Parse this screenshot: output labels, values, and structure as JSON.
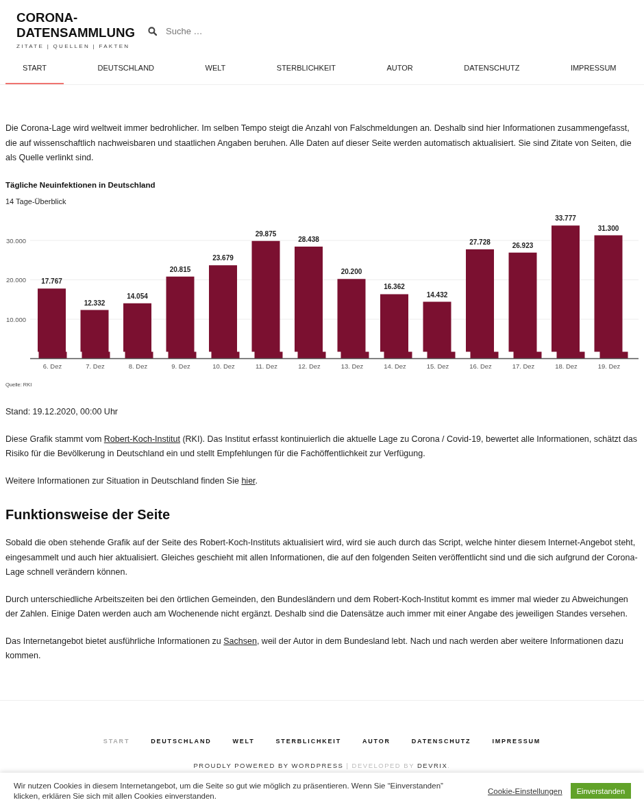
{
  "header": {
    "logo": "CORONA-DATENSAMMLUNG",
    "tagline": "ZITATE | QUELLEN | FAKTEN",
    "search": {
      "placeholder": "Suche …"
    }
  },
  "nav": {
    "items": [
      {
        "label": "START",
        "selected": true
      },
      {
        "label": "DEUTSCHLAND",
        "selected": false
      },
      {
        "label": "WELT",
        "selected": false
      },
      {
        "label": "STERBLICHKEIT",
        "selected": false
      },
      {
        "label": "AUTOR",
        "selected": false
      },
      {
        "label": "DATENSCHUTZ",
        "selected": false
      },
      {
        "label": "IMPRESSUM",
        "selected": false
      }
    ]
  },
  "content": [
    {
      "kind": "paragraph",
      "parts": [
        {
          "kind": "text",
          "text": "Die Corona-Lage wird weltweit immer bedrohlicher. Im selben Tempo steigt die Anzahl von Falschmeldungen an. Deshalb sind hier Informationen zusammengefasst, die auf wissenschaftlich nachweisbaren und staatlichen Angaben beruhen. Alle Daten auf dieser Seite werden automatisch aktualisiert. Sie sind Zitate von Seiten, die als Quelle verlinkt sind."
        }
      ]
    },
    {
      "kind": "chart",
      "subtitle": "14 Tage-Überblick",
      "source": "Quelle: RKI",
      "chart_data": {
        "type": "bar",
        "title": "Tägliche Neuinfektionen in Deutschland",
        "categories": [
          "6. Dez",
          "7. Dez",
          "8. Dez",
          "9. Dez",
          "10. Dez",
          "11. Dez",
          "12. Dez",
          "13. Dez",
          "14. Dez",
          "15. Dez",
          "16. Dez",
          "17. Dez",
          "18. Dez",
          "19. Dez"
        ],
        "values": [
          17767,
          12332,
          14054,
          20815,
          23679,
          29875,
          28438,
          20200,
          16362,
          14432,
          27728,
          26923,
          33777,
          31300
        ],
        "value_labels": [
          "17.767",
          "12.332",
          "14.054",
          "20.815",
          "23.679",
          "29.875",
          "28.438",
          "20.200",
          "16.362",
          "14.432",
          "27.728",
          "26.923",
          "33.777",
          "31.300"
        ],
        "ylim": [
          0,
          33777
        ],
        "yticks": [
          {
            "value": 10000,
            "label": "10.000"
          },
          {
            "value": 20000,
            "label": "20.000"
          },
          {
            "value": 30000,
            "label": "30.000"
          }
        ],
        "grid": true
      }
    },
    {
      "kind": "paragraph",
      "parts": [
        {
          "kind": "text",
          "text": "Stand: 19.12.2020, 00:00 Uhr"
        }
      ]
    },
    {
      "kind": "paragraph",
      "parts": [
        {
          "kind": "text",
          "text": "Diese Grafik stammt vom "
        },
        {
          "kind": "link",
          "text": "Robert-Koch-Institut"
        },
        {
          "kind": "text",
          "text": " (RKI). Das Institut erfasst kontinuierlich die aktuelle Lage zu Corona / Covid-19, bewertet alle Informationen, schätzt das Risiko für die Bevölkerung in Deutschland ein und stellt Empfehlungen für die Fachöffentlichkeit zur Verfügung."
        }
      ]
    },
    {
      "kind": "paragraph",
      "parts": [
        {
          "kind": "text",
          "text": "Weitere Informationen zur Situation in Deutschland finden Sie "
        },
        {
          "kind": "link",
          "text": "hier"
        },
        {
          "kind": "text",
          "text": "."
        }
      ]
    },
    {
      "kind": "heading",
      "text": "Funktionsweise der Seite"
    },
    {
      "kind": "paragraph",
      "parts": [
        {
          "kind": "text",
          "text": "Sobald die oben stehende Grafik auf der Seite des Robert-Koch-Instituts aktualisiert wird, wird sie auch durch das Script, welche hinter diesem Internet-Angebot steht, eingesammelt und auch hier aktualisiert. Gleiches geschieht mit allen Informationen, die auf den folgenden Seiten veröffentlicht sind und die sich aufgrund der Corona-Lage schnell verändern können."
        }
      ]
    },
    {
      "kind": "paragraph",
      "parts": [
        {
          "kind": "text",
          "text": "Durch unterschiedliche Arbeitszeiten bei den örtlichen Gemeinden, den Bundesländern und dem Robert-Koch-Institut kommt es immer mal wieder zu Abweichungen der Zahlen. Einige Daten werden auch am Wochenende nicht ergänzt. Deshalb sind die Datensätze auch immer mit einer Angabe des jeweiligen Standes versehen."
        }
      ]
    },
    {
      "kind": "paragraph",
      "parts": [
        {
          "kind": "text",
          "text": "Das Internetangebot bietet ausführliche Informationen zu "
        },
        {
          "kind": "link",
          "text": "Sachsen"
        },
        {
          "kind": "text",
          "text": ", weil der Autor in dem Bundesland lebt. Nach und nach werden aber weitere Informationen dazu kommen."
        }
      ]
    }
  ],
  "footer": {
    "nav": [
      {
        "label": "START",
        "selected": true
      },
      {
        "label": "DEUTSCHLAND",
        "selected": false
      },
      {
        "label": "WELT",
        "selected": false
      },
      {
        "label": "STERBLICHKEIT",
        "selected": false
      },
      {
        "label": "AUTOR",
        "selected": false
      },
      {
        "label": "DATENSCHUTZ",
        "selected": false
      },
      {
        "label": "IMPRESSUM",
        "selected": false
      }
    ],
    "credits": [
      {
        "kind": "link",
        "text": "PROUDLY POWERED BY WORDPRESS"
      },
      {
        "kind": "text",
        "text": " | DEVELOPED BY "
      },
      {
        "kind": "link",
        "text": "DEVRIX"
      },
      {
        "kind": "text",
        "text": "."
      }
    ]
  },
  "cookie_banner": {
    "text": "Wir nutzen Cookies in diesem Internetangebot, um die Seite so gut wie möglich zu präsentieren. Wenn Sie “Einverstanden” klicken, erklären Sie sich mit allen Cookies einverstanden.",
    "settings_link": "Cookie-Einstellungen",
    "button": "Einverstanden"
  }
}
